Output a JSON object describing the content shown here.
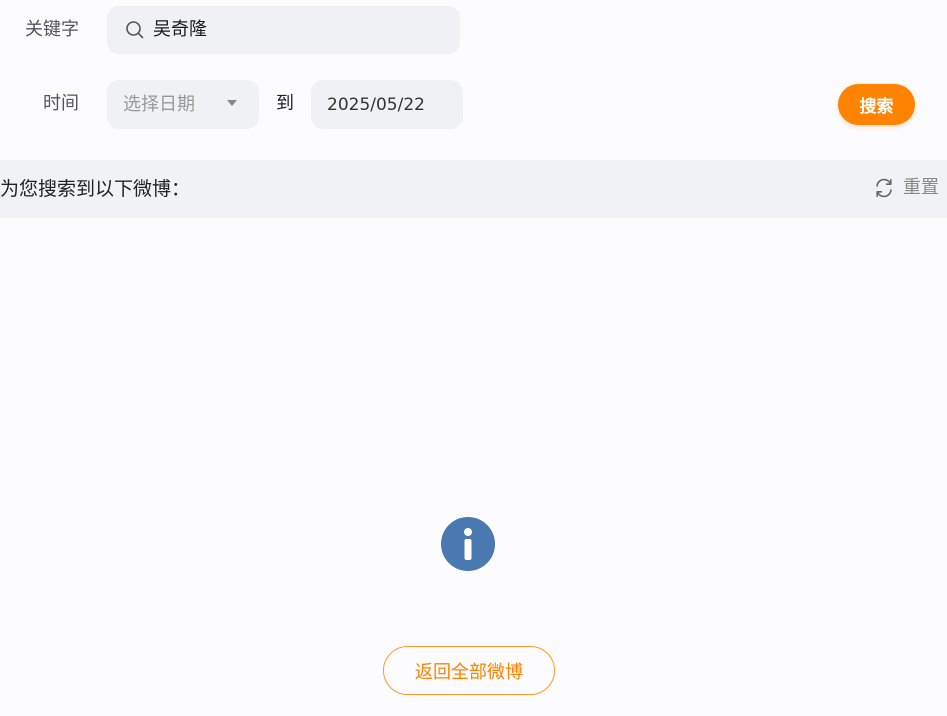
{
  "search_form": {
    "keyword_label": "关键字",
    "keyword_value": "吴奇隆",
    "time_label": "时间",
    "date_start_placeholder": "选择日期",
    "date_separator": "到",
    "date_end_value": "2025/05/22",
    "search_button_label": "搜索"
  },
  "results": {
    "header_text": "为您搜索到以下微博：",
    "reset_label": "重置",
    "back_button_label": "返回全部微博"
  },
  "colors": {
    "accent": "#ff8200",
    "info_icon": "#4a78b0",
    "field_bg": "#f0f1f5"
  },
  "icons": {
    "search": "search-icon",
    "caret": "chevron-down-icon",
    "reset": "refresh-icon",
    "info": "info-icon"
  }
}
